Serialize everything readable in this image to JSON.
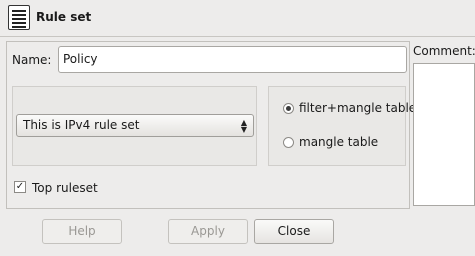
{
  "dialog": {
    "title": "Rule set",
    "icon": "list-icon"
  },
  "form": {
    "name_label": "Name:",
    "name_value": "Policy",
    "ip_version_selected": "This is IPv4 rule set",
    "table_options": [
      {
        "label": "filter+mangle table",
        "selected": true
      },
      {
        "label": "mangle table",
        "selected": false
      }
    ],
    "top_ruleset_label": "Top ruleset",
    "top_ruleset_checked": true,
    "comment_label": "Comment:",
    "comment_value": ""
  },
  "buttons": {
    "help_label": "Help",
    "apply_label": "Apply",
    "close_label": "Close"
  }
}
